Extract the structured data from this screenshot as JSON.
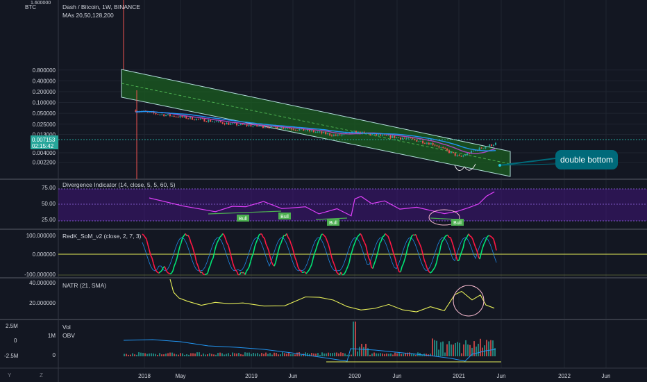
{
  "header": {
    "symbol": "Dash / Bitcoin, 1W, BINANCE",
    "mas": "MAs 20,50,128,200",
    "currency": "BTC",
    "top_tick": "1.600000"
  },
  "price_badge": {
    "price": "0.007153",
    "countdown": "02:15:42"
  },
  "annotation": {
    "label": "double bottom"
  },
  "panes": {
    "price": {
      "ticks": [
        "0.800000",
        "0.400000",
        "0.200000",
        "0.100000",
        "0.050000",
        "0.025000",
        "0.013000",
        "0.004000",
        "0.002200"
      ]
    },
    "divergence": {
      "title": "Divergence Indicator (14, close, 5, 5, 60, 5)",
      "ticks": [
        "75.00",
        "50.00",
        "25.00"
      ],
      "bull_labels": [
        "Bull",
        "Bull",
        "Bull",
        "Bull"
      ]
    },
    "som": {
      "title": "RedK_SoM_v2 (close, 2, 7, 3)",
      "ticks": [
        "100.000000",
        "0.000000",
        "-100.000000"
      ]
    },
    "natr": {
      "title": "NATR (21, SMA)",
      "ticks": [
        "40.000000",
        "20.000000"
      ]
    },
    "vol": {
      "title": "Vol",
      "title2": "OBV",
      "left_ticks": [
        "2.5M",
        "0",
        "-2.5M"
      ],
      "ticks": [
        "1M",
        "0"
      ]
    }
  },
  "time_axis": [
    "2018",
    "May",
    "2019",
    "Jun",
    "2020",
    "Jun",
    "2021",
    "Jun",
    "2022",
    "Jun"
  ],
  "axis_buttons": {
    "y": "Y",
    "z": "Z"
  },
  "colors": {
    "background": "#131722",
    "channel": "#1b5e20",
    "up": "#26a69a",
    "down": "#ef5350",
    "ma_blue": "#2196f3",
    "ma_purple": "#9c27b0",
    "osc_purple": "#e040fb",
    "som_green": "#00e676",
    "som_red": "#ff1744",
    "natr_yellow": "#e6ee58",
    "annotation": "#006a7a"
  },
  "chart_data": {
    "type": "line",
    "title": "Dash / Bitcoin, 1W, BINANCE",
    "x": [
      "2017-12",
      "2018-02",
      "2018-05",
      "2018-08",
      "2018-11",
      "2019-02",
      "2019-05",
      "2019-08",
      "2019-11",
      "2020-01",
      "2020-04",
      "2020-07",
      "2020-10",
      "2021-01",
      "2021-03",
      "2021-05"
    ],
    "series": [
      {
        "values": [
          0.06,
          0.05,
          0.04,
          0.032,
          0.025,
          0.022,
          0.02,
          0.016,
          0.012,
          0.015,
          0.012,
          0.01,
          0.007,
          0.003,
          0.005,
          0.0072
        ]
      }
    ],
    "ylim": [
      0.0022,
      1.6
    ],
    "yscale": "log",
    "last_price": 0.007153
  }
}
